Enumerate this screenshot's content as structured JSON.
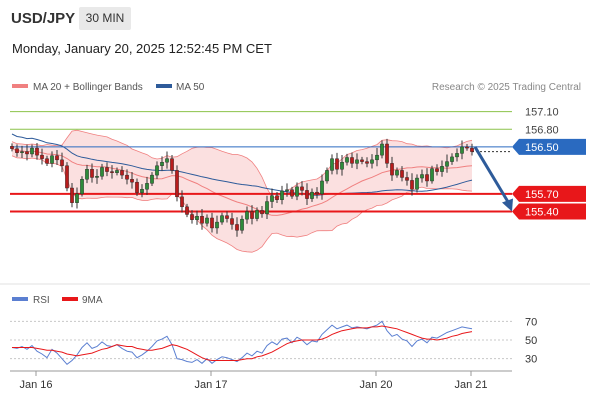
{
  "header": {
    "symbol": "USD/JPY",
    "timeframe": "30 MIN",
    "datetime": "Monday, January 20, 2025 12:52:45 PM CET"
  },
  "colors": {
    "bollinger": "#f08080",
    "bollinger_fill": "#fadada",
    "ma50": "#2e5b9a",
    "resistance": "#8cc24a",
    "support": "#e8171a",
    "current": "#2a6ac0",
    "up_candle": "#2e8b3a",
    "down_candle": "#b81c1c",
    "rsi": "#5b7fd1",
    "rsi_ma": "#e8171a",
    "grid": "#c8c8c8",
    "axis_text": "#333333"
  },
  "legend": {
    "bollinger_label": "MA 20 + Bollinger Bands",
    "ma50_label": "MA 50",
    "credit": "Research © 2025 Trading Central",
    "rsi_label": "RSI",
    "rsi_ma_label": "9MA"
  },
  "chart_data": [
    {
      "type": "candlestick",
      "title": "USD/JPY 30 MIN",
      "ylim": [
        154.2,
        157.35
      ],
      "x_ticks": [
        "Jan 16",
        "Jan 17",
        "Jan 20",
        "Jan 21"
      ],
      "levels": [
        {
          "label": "157.10",
          "value": 157.1,
          "kind": "resistance"
        },
        {
          "label": "156.80",
          "value": 156.8,
          "kind": "resistance"
        },
        {
          "label": "156.50",
          "value": 156.5,
          "kind": "current"
        },
        {
          "label": "155.70",
          "value": 155.7,
          "kind": "support"
        },
        {
          "label": "155.40",
          "value": 155.4,
          "kind": "support"
        }
      ],
      "last_price": 156.42,
      "forecast_arrow": {
        "from": 156.5,
        "to": 155.4
      },
      "series_close": [
        156.47,
        156.4,
        156.42,
        156.38,
        156.48,
        156.36,
        156.3,
        156.22,
        156.35,
        156.28,
        156.18,
        155.8,
        155.55,
        155.7,
        155.95,
        156.12,
        155.98,
        156.0,
        156.15,
        156.08,
        156.06,
        156.1,
        156.02,
        155.95,
        155.9,
        155.72,
        155.78,
        155.88,
        156.02,
        156.18,
        156.24,
        156.3,
        156.1,
        155.65,
        155.48,
        155.35,
        155.26,
        155.32,
        155.2,
        155.29,
        155.12,
        155.22,
        155.33,
        155.28,
        155.18,
        155.08,
        155.27,
        155.4,
        155.28,
        155.42,
        155.36,
        155.57,
        155.67,
        155.6,
        155.75,
        155.77,
        155.66,
        155.82,
        155.76,
        155.62,
        155.73,
        155.7,
        155.92,
        156.1,
        156.3,
        156.12,
        156.24,
        156.32,
        156.22,
        156.28,
        156.25,
        156.22,
        156.28,
        156.36,
        156.55,
        156.22,
        156.02,
        156.1,
        155.98,
        155.93,
        155.78,
        155.97,
        156.03,
        155.92,
        156.13,
        156.08,
        156.17,
        156.25,
        156.33,
        156.39,
        156.5,
        156.48,
        156.42
      ],
      "rsi_ylim": [
        20,
        80
      ],
      "rsi_levels": [
        70,
        50,
        30
      ],
      "rsi_values": [
        42,
        41,
        43,
        40,
        44,
        38,
        35,
        31,
        40,
        36,
        30,
        24,
        28,
        34,
        42,
        47,
        41,
        43,
        48,
        44,
        43,
        45,
        41,
        38,
        37,
        31,
        34,
        38,
        43,
        49,
        51,
        54,
        45,
        30,
        29,
        27,
        26,
        29,
        25,
        30,
        25,
        29,
        32,
        31,
        29,
        27,
        31,
        36,
        33,
        38,
        36,
        44,
        48,
        45,
        51,
        52,
        47,
        53,
        50,
        45,
        49,
        48,
        56,
        61,
        66,
        62,
        64,
        66,
        63,
        64,
        63,
        62,
        64,
        66,
        70,
        60,
        54,
        56,
        51,
        49,
        43,
        49,
        51,
        47,
        53,
        52,
        55,
        58,
        60,
        62,
        64,
        63,
        62
      ],
      "rsi_ma_values": [
        42,
        42,
        42,
        42,
        42,
        41,
        40,
        39,
        39,
        38,
        37,
        35,
        34,
        33,
        34,
        35,
        36,
        38,
        40,
        41,
        43,
        45,
        44,
        43,
        43,
        41,
        40,
        39,
        39,
        40,
        41,
        43,
        45,
        44,
        42,
        40,
        37,
        34,
        31,
        29,
        28,
        28,
        28,
        28,
        28,
        28,
        29,
        30,
        30,
        32,
        33,
        35,
        37,
        40,
        43,
        46,
        48,
        49,
        50,
        50,
        50,
        50,
        51,
        53,
        56,
        58,
        60,
        61,
        62,
        63,
        63,
        63,
        64,
        64,
        65,
        64,
        63,
        62,
        60,
        58,
        56,
        54,
        52,
        51,
        51,
        50,
        51,
        52,
        54,
        55,
        57,
        58,
        59
      ]
    }
  ]
}
